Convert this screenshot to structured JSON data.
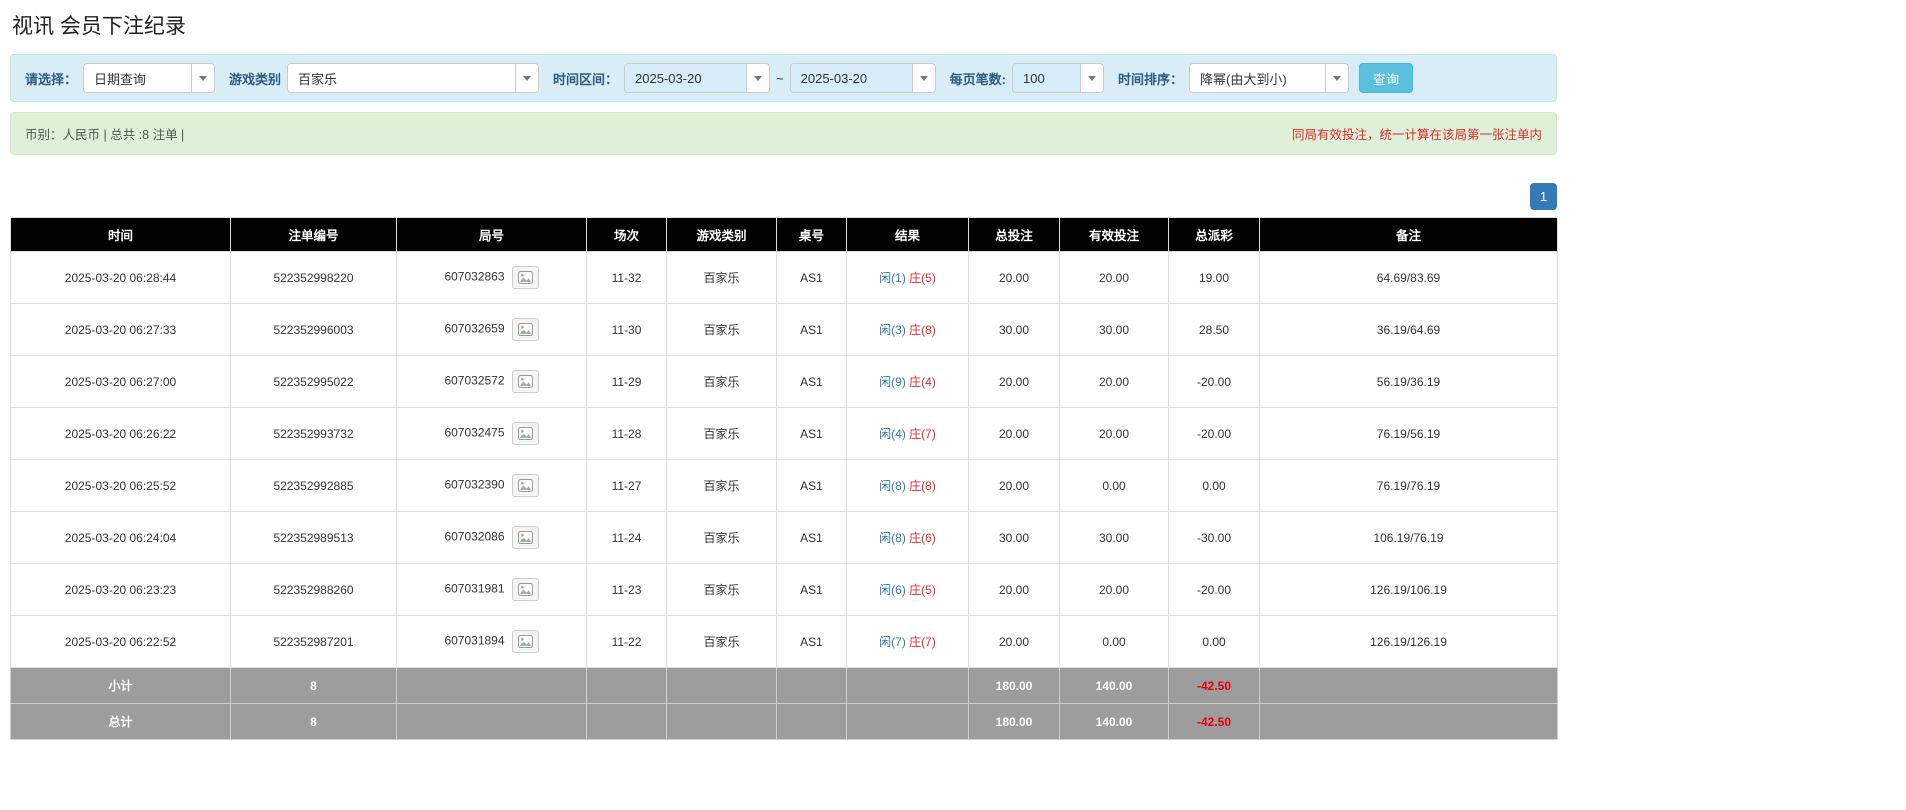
{
  "page": {
    "title": "视讯 会员下注纪录"
  },
  "colors": {
    "accent_blue": "#337ab7",
    "negative_red": "#e02b2b",
    "header_bg": "#020202",
    "filter_bar_bg": "#d9edf7",
    "info_bar_bg": "#dff0d8",
    "search_button_bg": "#5bc0de",
    "summary_row_bg": "#9d9d9d"
  },
  "filters": {
    "select_label": "请选择：",
    "select_value": "日期查询",
    "game_type_label": "游戏类别",
    "game_type_value": "百家乐",
    "date_range_label": "时间区间：",
    "date_from": "2025-03-20",
    "range_separator": "~",
    "date_to": "2025-03-20",
    "page_size_label": "每页笔数:",
    "page_size_value": "100",
    "sort_label": "时间排序：",
    "sort_value": "降幂(由大到小)",
    "search_button": "查询"
  },
  "info_bar": {
    "left_text": "币别：人民币 | 总共 :8 注单 |",
    "right_text": "同局有效投注，统一计算在该局第一张注单内"
  },
  "pagination": {
    "current_page": "1"
  },
  "table": {
    "headers": [
      "时间",
      "注单编号",
      "局号",
      "场次",
      "游戏类别",
      "桌号",
      "结果",
      "总投注",
      "有效投注",
      "总派彩",
      "备注"
    ],
    "rows": [
      {
        "time": "2025-03-20 06:28:44",
        "bet_id": "522352998220",
        "round_id": "607032863",
        "session": "11-32",
        "game_type": "百家乐",
        "table_no": "AS1",
        "result_player": "闲(1)",
        "result_banker": "庄(5)",
        "total_bet": "20.00",
        "valid_bet": "20.00",
        "payout": "19.00",
        "remark": "64.69/83.69"
      },
      {
        "time": "2025-03-20 06:27:33",
        "bet_id": "522352996003",
        "round_id": "607032659",
        "session": "11-30",
        "game_type": "百家乐",
        "table_no": "AS1",
        "result_player": "闲(3)",
        "result_banker": "庄(8)",
        "total_bet": "30.00",
        "valid_bet": "30.00",
        "payout": "28.50",
        "remark": "36.19/64.69"
      },
      {
        "time": "2025-03-20 06:27:00",
        "bet_id": "522352995022",
        "round_id": "607032572",
        "session": "11-29",
        "game_type": "百家乐",
        "table_no": "AS1",
        "result_player": "闲(9)",
        "result_banker": "庄(4)",
        "total_bet": "20.00",
        "valid_bet": "20.00",
        "payout": "-20.00",
        "remark": "56.19/36.19"
      },
      {
        "time": "2025-03-20 06:26:22",
        "bet_id": "522352993732",
        "round_id": "607032475",
        "session": "11-28",
        "game_type": "百家乐",
        "table_no": "AS1",
        "result_player": "闲(4)",
        "result_banker": "庄(7)",
        "total_bet": "20.00",
        "valid_bet": "20.00",
        "payout": "-20.00",
        "remark": "76.19/56.19"
      },
      {
        "time": "2025-03-20 06:25:52",
        "bet_id": "522352992885",
        "round_id": "607032390",
        "session": "11-27",
        "game_type": "百家乐",
        "table_no": "AS1",
        "result_player": "闲(8)",
        "result_banker": "庄(8)",
        "total_bet": "20.00",
        "valid_bet": "0.00",
        "payout": "0.00",
        "remark": "76.19/76.19"
      },
      {
        "time": "2025-03-20 06:24:04",
        "bet_id": "522352989513",
        "round_id": "607032086",
        "session": "11-24",
        "game_type": "百家乐",
        "table_no": "AS1",
        "result_player": "闲(8)",
        "result_banker": "庄(6)",
        "total_bet": "30.00",
        "valid_bet": "30.00",
        "payout": "-30.00",
        "remark": "106.19/76.19"
      },
      {
        "time": "2025-03-20 06:23:23",
        "bet_id": "522352988260",
        "round_id": "607031981",
        "session": "11-23",
        "game_type": "百家乐",
        "table_no": "AS1",
        "result_player": "闲(6)",
        "result_banker": "庄(5)",
        "total_bet": "20.00",
        "valid_bet": "20.00",
        "payout": "-20.00",
        "remark": "126.19/106.19"
      },
      {
        "time": "2025-03-20 06:22:52",
        "bet_id": "522352987201",
        "round_id": "607031894",
        "session": "11-22",
        "game_type": "百家乐",
        "table_no": "AS1",
        "result_player": "闲(7)",
        "result_banker": "庄(7)",
        "total_bet": "20.00",
        "valid_bet": "0.00",
        "payout": "0.00",
        "remark": "126.19/126.19"
      }
    ],
    "subtotal": {
      "label": "小计",
      "count": "8",
      "total_bet": "180.00",
      "valid_bet": "140.00",
      "payout": "-42.50"
    },
    "total": {
      "label": "总计",
      "count": "8",
      "total_bet": "180.00",
      "valid_bet": "140.00",
      "payout": "-42.50"
    }
  }
}
